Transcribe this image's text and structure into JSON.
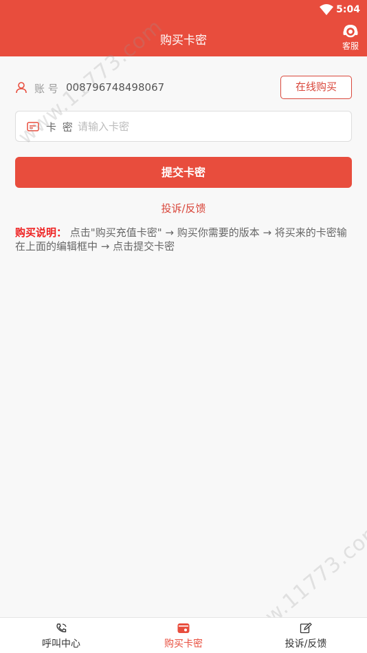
{
  "status_bar": {
    "time": "5:04"
  },
  "header": {
    "title": "购买卡密",
    "support_label": "客服"
  },
  "account": {
    "label": "账 号",
    "value": "008796748498067",
    "buy_online_label": "在线购买"
  },
  "card_field": {
    "label": "卡 密",
    "placeholder": "请输入卡密",
    "value": ""
  },
  "submit_label": "提交卡密",
  "complaint_label": "投诉/反馈",
  "instructions": {
    "title": "购买说明：",
    "text": "点击\"购买充值卡密\" → 购买你需要的版本 → 将买来的卡密输在上面的编辑框中 → 点击提交卡密"
  },
  "tabs": [
    {
      "label": "呼叫中心",
      "icon": "phone-icon",
      "active": false
    },
    {
      "label": "购买卡密",
      "icon": "wallet-icon",
      "active": true
    },
    {
      "label": "投诉/反馈",
      "icon": "edit-icon",
      "active": false
    }
  ],
  "watermark": "www.11773.com",
  "colors": {
    "primary": "#e84d3d",
    "accent_text": "#d9463a",
    "background": "#f8f8f8"
  }
}
